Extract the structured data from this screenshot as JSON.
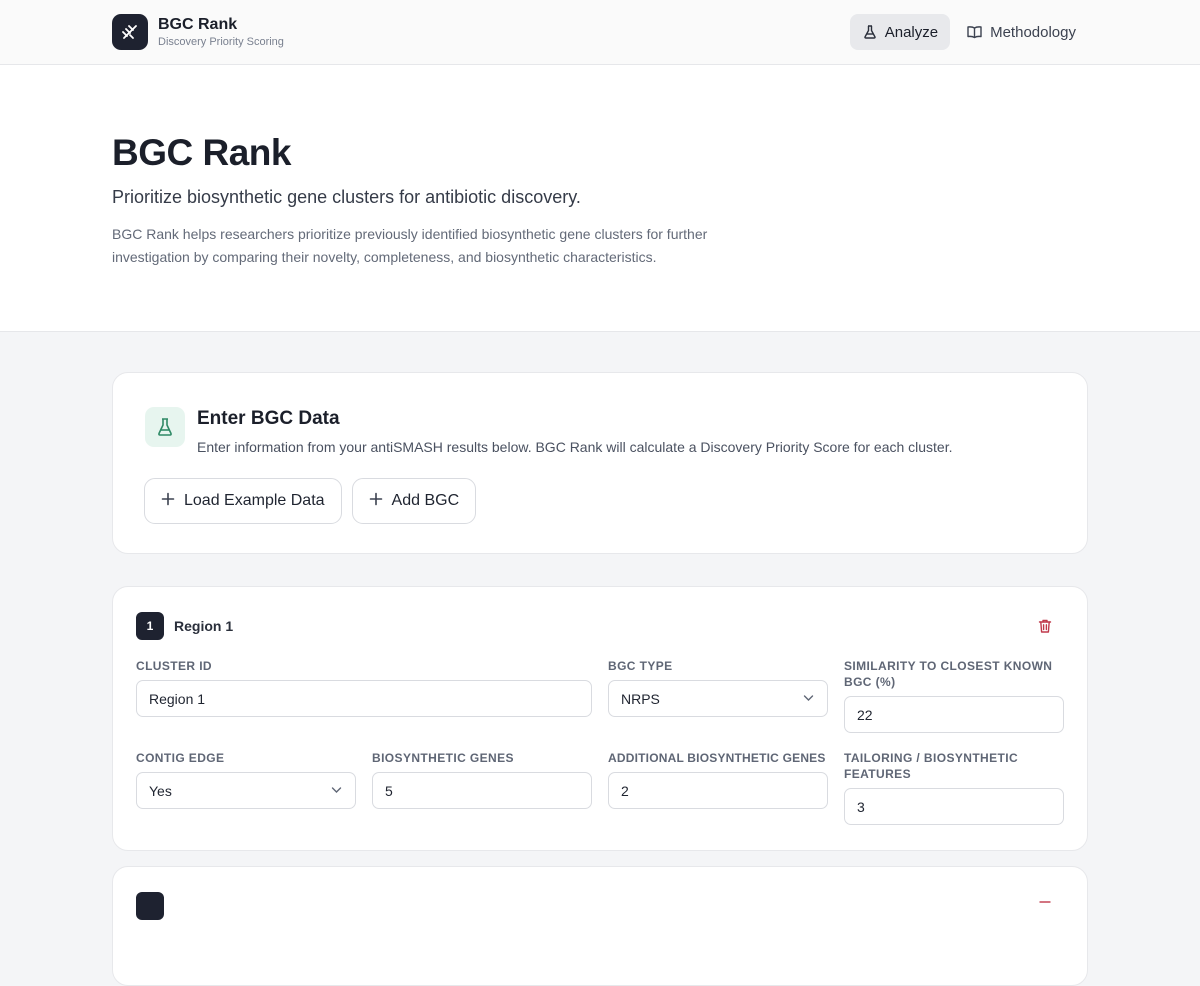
{
  "header": {
    "brand_name": "BGC Rank",
    "brand_subtitle": "Discovery Priority Scoring",
    "nav": [
      {
        "label": "Analyze",
        "icon": "flask-icon",
        "active": true
      },
      {
        "label": "Methodology",
        "icon": "book-icon",
        "active": false
      }
    ]
  },
  "hero": {
    "title": "BGC Rank",
    "tagline": "Prioritize biosynthetic gene clusters for antibiotic discovery.",
    "description": "BGC Rank helps researchers prioritize previously identified biosynthetic gene clusters for further investigation by comparing their novelty, completeness, and biosynthetic characteristics."
  },
  "enter": {
    "icon": "flask-icon",
    "title": "Enter BGC Data",
    "description": "Enter information from your antiSMASH results below. BGC Rank will calculate a Discovery Priority Score for each cluster.",
    "load_example_label": "Load Example Data",
    "add_bgc_label": "Add BGC"
  },
  "regions": [
    {
      "number": "1",
      "title": "Region 1",
      "fields": {
        "cluster_id": {
          "label": "Cluster ID",
          "value": "Region 1"
        },
        "bgc_type": {
          "label": "BGC Type",
          "value": "NRPS"
        },
        "similarity": {
          "label": "Similarity to closest known BGC (%)",
          "value": "22"
        },
        "contig_edge": {
          "label": "Contig Edge",
          "value": "Yes"
        },
        "biosynthetic_genes": {
          "label": "Biosynthetic Genes",
          "value": "5"
        },
        "additional_genes": {
          "label": "Additional Biosynthetic Genes",
          "value": "2"
        },
        "tailoring": {
          "label": "Tailoring / Biosynthetic Features",
          "value": "3"
        }
      }
    }
  ],
  "colors": {
    "dark": "#1e2230",
    "accent_green": "#2f8a66",
    "delete_red": "#c0394b"
  }
}
